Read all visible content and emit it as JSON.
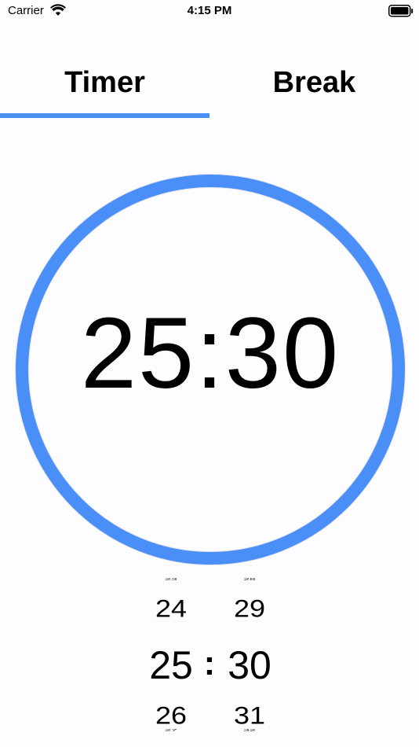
{
  "status_bar": {
    "carrier": "Carrier",
    "time": "4:15 PM",
    "icons": [
      "wifi-icon",
      "battery-icon"
    ]
  },
  "tabs": [
    {
      "label": "Timer",
      "selected": true
    },
    {
      "label": "Break",
      "selected": false
    }
  ],
  "colors": {
    "accent": "#4a8ef8",
    "background": "#fdfcff",
    "text": "#000000"
  },
  "timer": {
    "display": "25:30",
    "ring_progress": 1.0
  },
  "picker": {
    "separator": ":",
    "minutes": {
      "far_above": "23",
      "above": "24",
      "selected": "25",
      "below": "26",
      "far_below": "27"
    },
    "seconds": {
      "far_above": "28",
      "above": "29",
      "selected": "30",
      "below": "31",
      "far_below": "32"
    }
  }
}
